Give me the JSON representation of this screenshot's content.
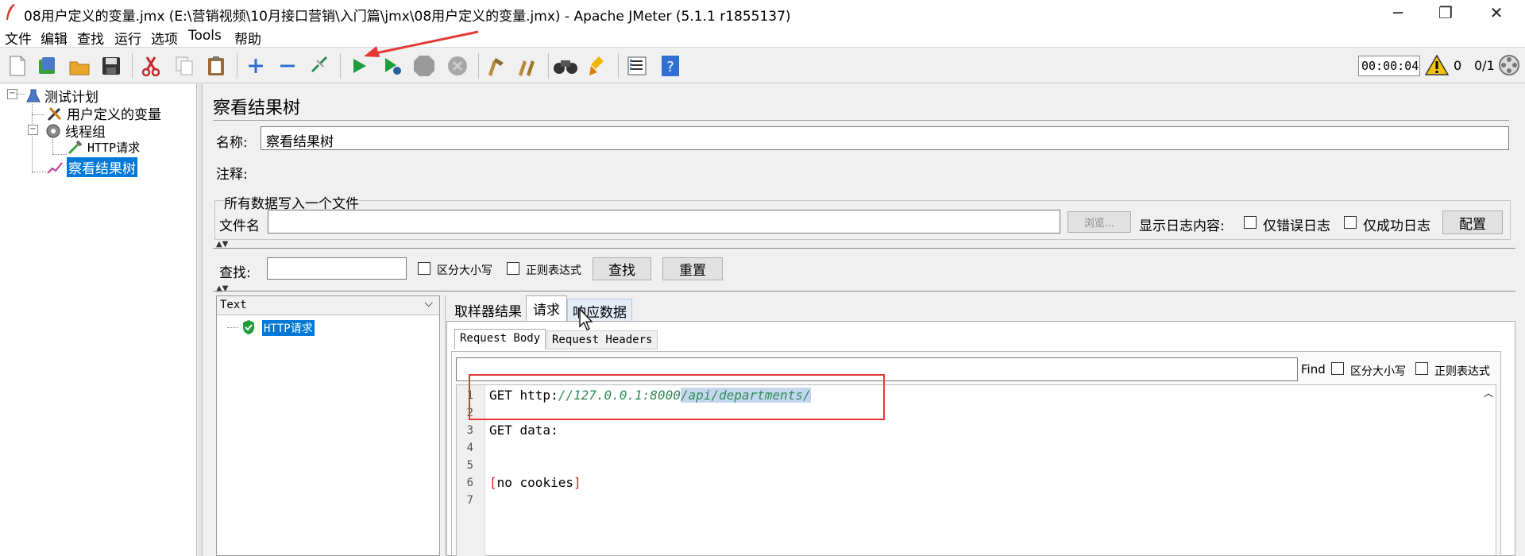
{
  "window": {
    "title": "08用户定义的变量.jmx (E:\\营销视频\\10月接口营销\\入门篇\\jmx\\08用户定义的变量.jmx) - Apache JMeter (5.1.1 r1855137)",
    "controls": {
      "minimize": "─",
      "restore": "❐",
      "close": "✕"
    }
  },
  "menu": [
    "文件",
    "编辑",
    "查找",
    "运行",
    "选项",
    "Tools",
    "帮助"
  ],
  "toolbar": {
    "timer": "00:00:04",
    "warn_count": "0",
    "threads": "0/1"
  },
  "tree": {
    "plan": "测试计划",
    "udv": "用户定义的变量",
    "thread_group": "线程组",
    "http": "HTTP请求",
    "listener": "察看结果树"
  },
  "panel": {
    "title": "察看结果树",
    "name_label": "名称:",
    "name_value": "察看结果树",
    "comment_label": "注释:",
    "file_group": "所有数据写入一个文件",
    "filename_label": "文件名",
    "browse": "浏览...",
    "log_label": "显示日志内容:",
    "only_errors": "仅错误日志",
    "only_success": "仅成功日志",
    "configure": "配置",
    "search_label": "查找:",
    "case_sensitive": "区分大小写",
    "regex": "正则表达式",
    "find_btn": "查找",
    "reset_btn": "重置"
  },
  "results": {
    "renderer": "Text",
    "sample": "HTTP请求"
  },
  "tabs": [
    "取样器结果",
    "请求",
    "响应数据"
  ],
  "subtabs": [
    "Request Body",
    "Request Headers"
  ],
  "find_bar": {
    "find": "Find",
    "case_sensitive": "区分大小写",
    "regex": "正则表达式"
  },
  "code": {
    "line_numbers": [
      "1",
      "2",
      "3",
      "4",
      "5",
      "6",
      "7"
    ],
    "line1_method": "GET http:",
    "line1_host": "//127.0.0.1:8000",
    "line1_path": "/api/departments/",
    "line3": "GET data:",
    "line6_open": "[",
    "line6_text": "no cookies",
    "line6_close": "]"
  },
  "colors": {
    "selection": "#0078d7",
    "annotation_red": "#e53935",
    "code_green": "#2e8b57",
    "path_highlight": "#c5d7ee"
  }
}
